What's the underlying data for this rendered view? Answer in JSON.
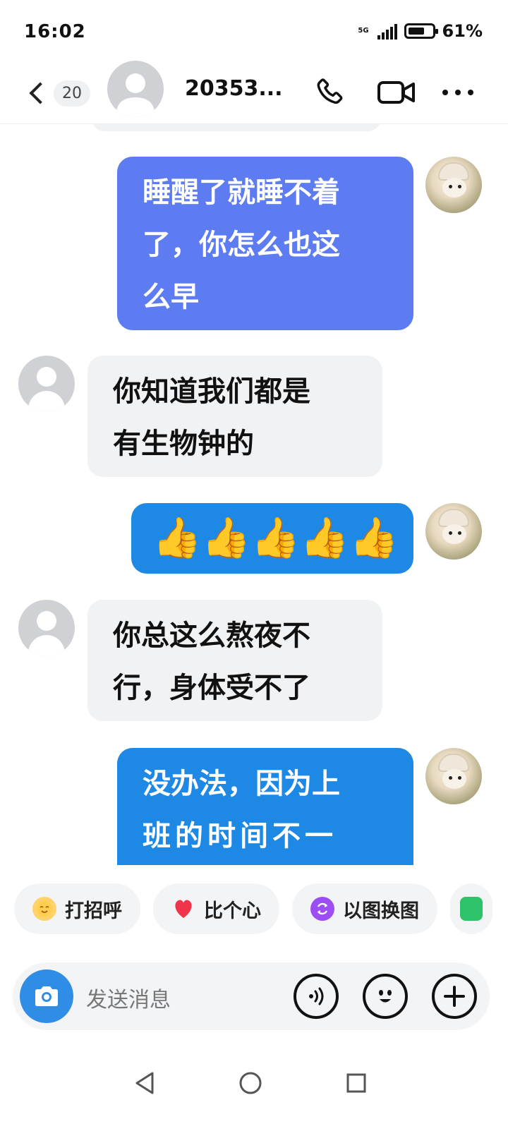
{
  "status_bar": {
    "time": "16:02",
    "network": "5G",
    "battery": "61%"
  },
  "header": {
    "unread_count": "20",
    "contact_name": "20353..."
  },
  "messages": [
    {
      "side": "me",
      "text_lines": [
        "睡醒了就睡不着",
        "了，你怎么也这",
        "么早"
      ],
      "color": "#5d7cf2"
    },
    {
      "side": "them",
      "text_lines": [
        "你知道我们都是",
        "有生物钟的"
      ]
    },
    {
      "side": "me",
      "thumbs_count": 5,
      "color": "#1e88e5"
    },
    {
      "side": "them",
      "text_lines": [
        "你总这么熬夜不",
        "行，身体受不了"
      ]
    },
    {
      "side": "me",
      "text_lines": [
        "没办法，因为上",
        "班的时间不一"
      ],
      "color": "#1e88e5"
    }
  ],
  "chips": [
    {
      "label": "打招呼",
      "icon": "wave-hand-icon"
    },
    {
      "label": "比个心",
      "icon": "heart-icon"
    },
    {
      "label": "以图换图",
      "icon": "swap-image-icon"
    }
  ],
  "input": {
    "placeholder": "发送消息"
  }
}
